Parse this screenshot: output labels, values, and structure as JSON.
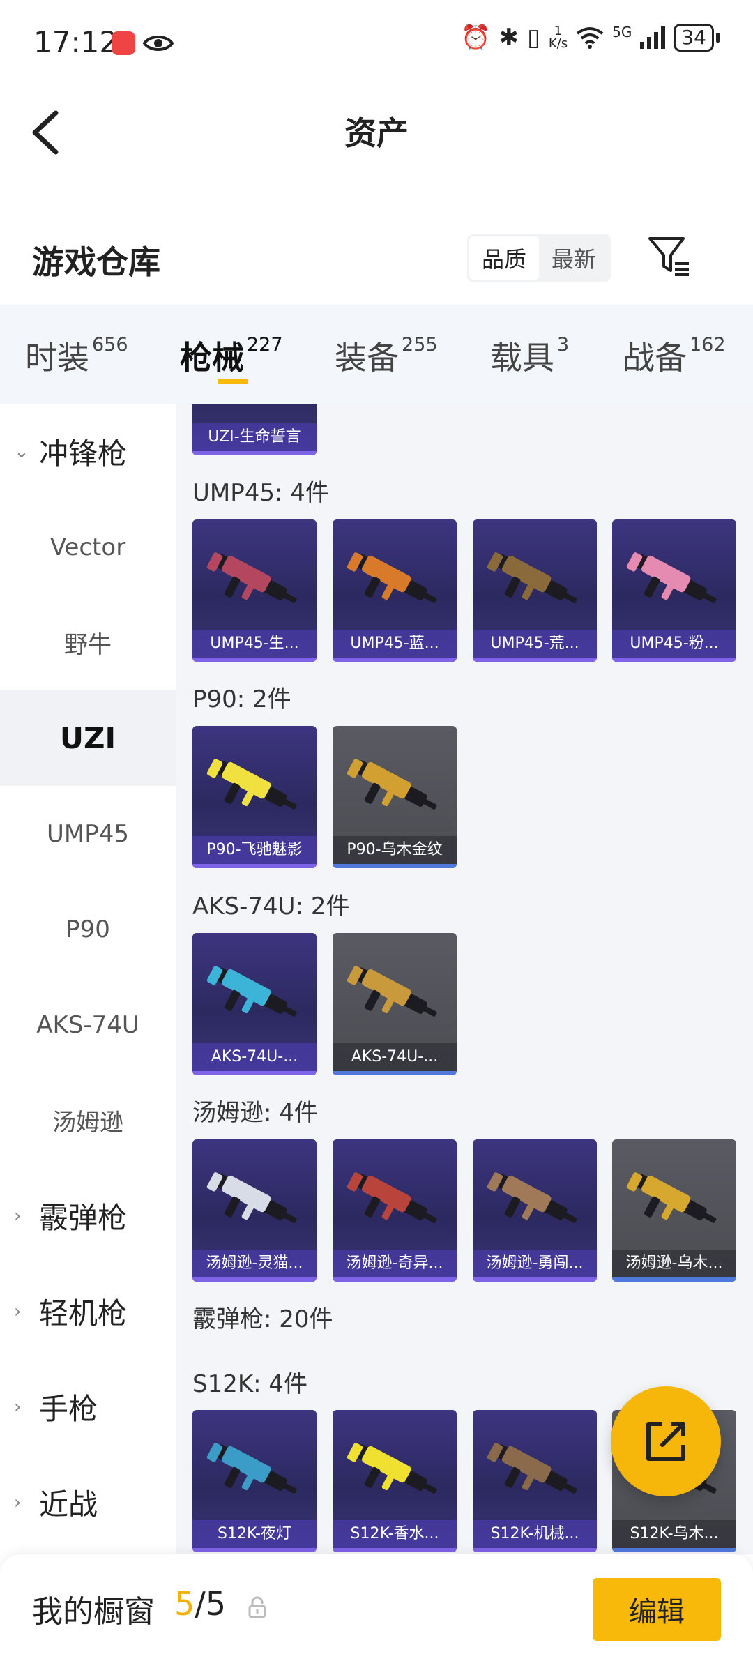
{
  "status_bar": {
    "time": "17:12",
    "speed_value": "1",
    "speed_unit": "K/s",
    "network": "5G",
    "battery": "34",
    "icons": [
      "app-notification-icon",
      "eye-icon",
      "alarm-icon",
      "bluetooth-icon",
      "vibrate-icon",
      "wifi-icon",
      "signal-icon",
      "battery-icon"
    ]
  },
  "header": {
    "title": "资产",
    "back_icon": "chevron-left-icon"
  },
  "warehouse": {
    "title": "游戏仓库",
    "sort_options": [
      "品质",
      "最新"
    ],
    "active_sort": "品质",
    "filter_icon": "filter-icon"
  },
  "tabs": [
    {
      "label": "时装",
      "count": "656"
    },
    {
      "label": "枪械",
      "count": "227",
      "active": true
    },
    {
      "label": "装备",
      "count": "255"
    },
    {
      "label": "载具",
      "count": "3"
    },
    {
      "label": "战备",
      "count": "162"
    }
  ],
  "sidebar": {
    "items": [
      {
        "label": "冲锋枪",
        "type": "group",
        "expanded": true
      },
      {
        "label": "Vector",
        "type": "sub"
      },
      {
        "label": "野牛",
        "type": "sub"
      },
      {
        "label": "UZI",
        "type": "sub",
        "active": true
      },
      {
        "label": "UMP45",
        "type": "sub"
      },
      {
        "label": "P90",
        "type": "sub"
      },
      {
        "label": "AKS-74U",
        "type": "sub"
      },
      {
        "label": "汤姆逊",
        "type": "sub"
      },
      {
        "label": "霰弹枪",
        "type": "group",
        "expanded": false
      },
      {
        "label": "轻机枪",
        "type": "group",
        "expanded": false
      },
      {
        "label": "手枪",
        "type": "group",
        "expanded": false
      },
      {
        "label": "近战",
        "type": "group",
        "expanded": false
      }
    ]
  },
  "content": {
    "top_partial_card": "UZI-生命誓言",
    "sections": [
      {
        "title": "UMP45: 4件",
        "items": [
          {
            "name": "UMP45-生...",
            "rarity": "purple",
            "color": "#b4475f"
          },
          {
            "name": "UMP45-蓝...",
            "rarity": "purple",
            "color": "#d97a2a"
          },
          {
            "name": "UMP45-荒...",
            "rarity": "purple",
            "color": "#8a6a3a"
          },
          {
            "name": "UMP45-粉...",
            "rarity": "purple",
            "color": "#e58ab0"
          }
        ]
      },
      {
        "title": "P90: 2件",
        "items": [
          {
            "name": "P90-飞驰魅影",
            "rarity": "purple",
            "color": "#f0e040"
          },
          {
            "name": "P90-乌木金纹",
            "rarity": "gray",
            "color": "#d2a030"
          }
        ]
      },
      {
        "title": "AKS-74U: 2件",
        "items": [
          {
            "name": "AKS-74U-...",
            "rarity": "purple",
            "color": "#3cb4d8"
          },
          {
            "name": "AKS-74U-...",
            "rarity": "gray",
            "color": "#c89a3c"
          }
        ]
      },
      {
        "title": "汤姆逊: 4件",
        "items": [
          {
            "name": "汤姆逊-灵猫...",
            "rarity": "purple",
            "color": "#d8dce6"
          },
          {
            "name": "汤姆逊-奇异...",
            "rarity": "purple",
            "color": "#b8443c"
          },
          {
            "name": "汤姆逊-勇闯...",
            "rarity": "purple",
            "color": "#a07a58"
          },
          {
            "name": "汤姆逊-乌木...",
            "rarity": "gray",
            "color": "#d6a830"
          }
        ]
      },
      {
        "title": "霰弹枪: 20件",
        "items": []
      },
      {
        "title": "S12K: 4件",
        "items": [
          {
            "name": "S12K-夜灯",
            "rarity": "purple",
            "color": "#3c9cc8"
          },
          {
            "name": "S12K-香水...",
            "rarity": "purple",
            "color": "#f0e030"
          },
          {
            "name": "S12K-机械...",
            "rarity": "purple",
            "color": "#8a6a4a"
          },
          {
            "name": "S12K-乌木...",
            "rarity": "gray",
            "color": "#d2a030"
          }
        ]
      }
    ]
  },
  "fab": {
    "icon": "share-external-icon"
  },
  "bottom_bar": {
    "label": "我的橱窗",
    "count_current": "5",
    "count_separator": "/",
    "count_total": "5",
    "lock_icon": "lock-icon",
    "edit_label": "编辑"
  },
  "colors": {
    "accent": "#f8b90a",
    "rarity_purple": "#7e62e8",
    "rarity_gray": "#5078dd"
  }
}
